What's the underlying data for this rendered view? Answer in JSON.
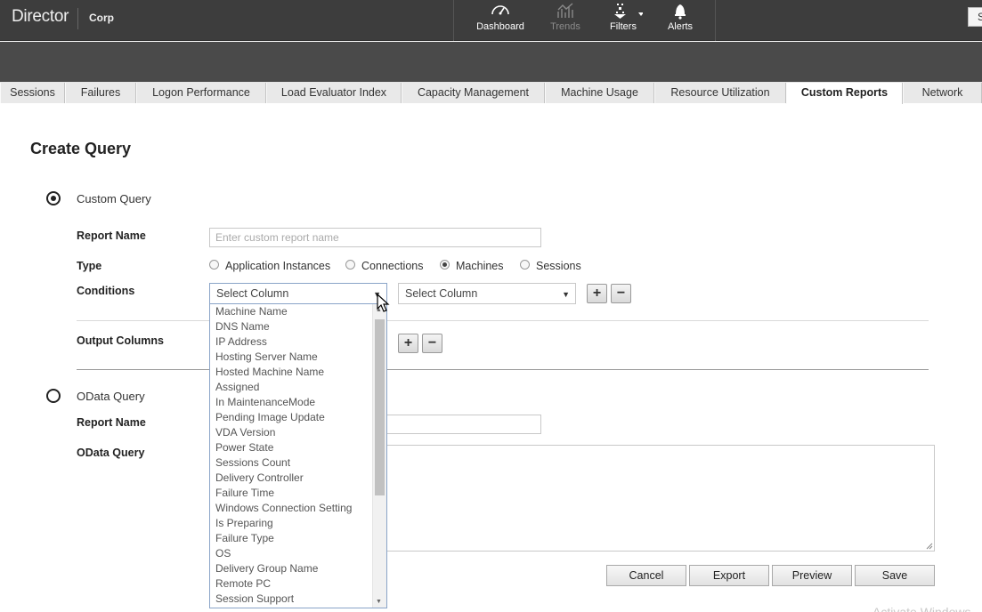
{
  "header": {
    "brand": "Director",
    "site": "Corp",
    "nav": [
      {
        "label": "Dashboard",
        "icon": "dashboard-gauge-icon"
      },
      {
        "label": "Trends",
        "icon": "trends-chart-icon"
      },
      {
        "label": "Filters",
        "icon": "filters-icon"
      },
      {
        "label": "Alerts",
        "icon": "alerts-bell-icon"
      }
    ],
    "corner_button": "S"
  },
  "tabs": [
    "Sessions",
    "Failures",
    "Logon Performance",
    "Load Evaluator Index",
    "Capacity Management",
    "Machine Usage",
    "Resource Utilization",
    "Custom Reports",
    "Network"
  ],
  "active_tab": "Custom Reports",
  "page_title": "Create Query",
  "custom_query": {
    "label": "Custom Query",
    "selected": true,
    "report_name_label": "Report Name",
    "report_name_placeholder": "Enter custom report name",
    "report_name_value": "",
    "type_label": "Type",
    "type_options": [
      "Application Instances",
      "Connections",
      "Machines",
      "Sessions"
    ],
    "type_selected": "Machines",
    "conditions_label": "Conditions",
    "condition_column": "Select Column",
    "condition_operator": "Select Column",
    "output_columns_label": "Output Columns"
  },
  "odata_query": {
    "label": "OData Query",
    "selected": false,
    "report_name_label": "Report Name",
    "query_label": "OData Query"
  },
  "dropdown_items": [
    "Machine Name",
    "DNS Name",
    "IP Address",
    "Hosting Server Name",
    "Hosted Machine Name",
    "Assigned",
    "In MaintenanceMode",
    "Pending Image Update",
    "VDA Version",
    "Power State",
    "Sessions Count",
    "Delivery Controller",
    "Failure Time",
    "Windows Connection Setting",
    "Is Preparing",
    "Failure Type",
    "OS",
    "Delivery Group Name",
    "Remote PC",
    "Session Support"
  ],
  "buttons": {
    "cancel": "Cancel",
    "export": "Export",
    "preview": "Preview",
    "save": "Save",
    "add": "+",
    "remove": "−"
  },
  "watermark": "Activate Windows"
}
